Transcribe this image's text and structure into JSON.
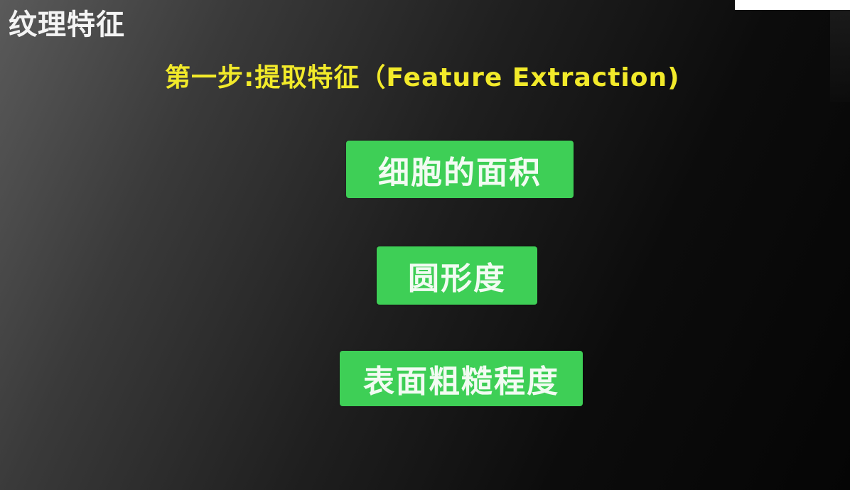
{
  "slide": {
    "title": "纹理特征",
    "step_title": "第一步:提取特征（Feature Extraction)"
  },
  "features": [
    {
      "label": "细胞的面积"
    },
    {
      "label": "圆形度"
    },
    {
      "label": "表面粗糙程度"
    }
  ],
  "colors": {
    "title_text": "#f4f4f4",
    "step_title_text": "#f2ea2a",
    "feature_box_bg": "#3ecf56",
    "feature_box_text": "#f2fbf2",
    "background_light": "#5a5a5a",
    "background_dark": "#050505"
  }
}
